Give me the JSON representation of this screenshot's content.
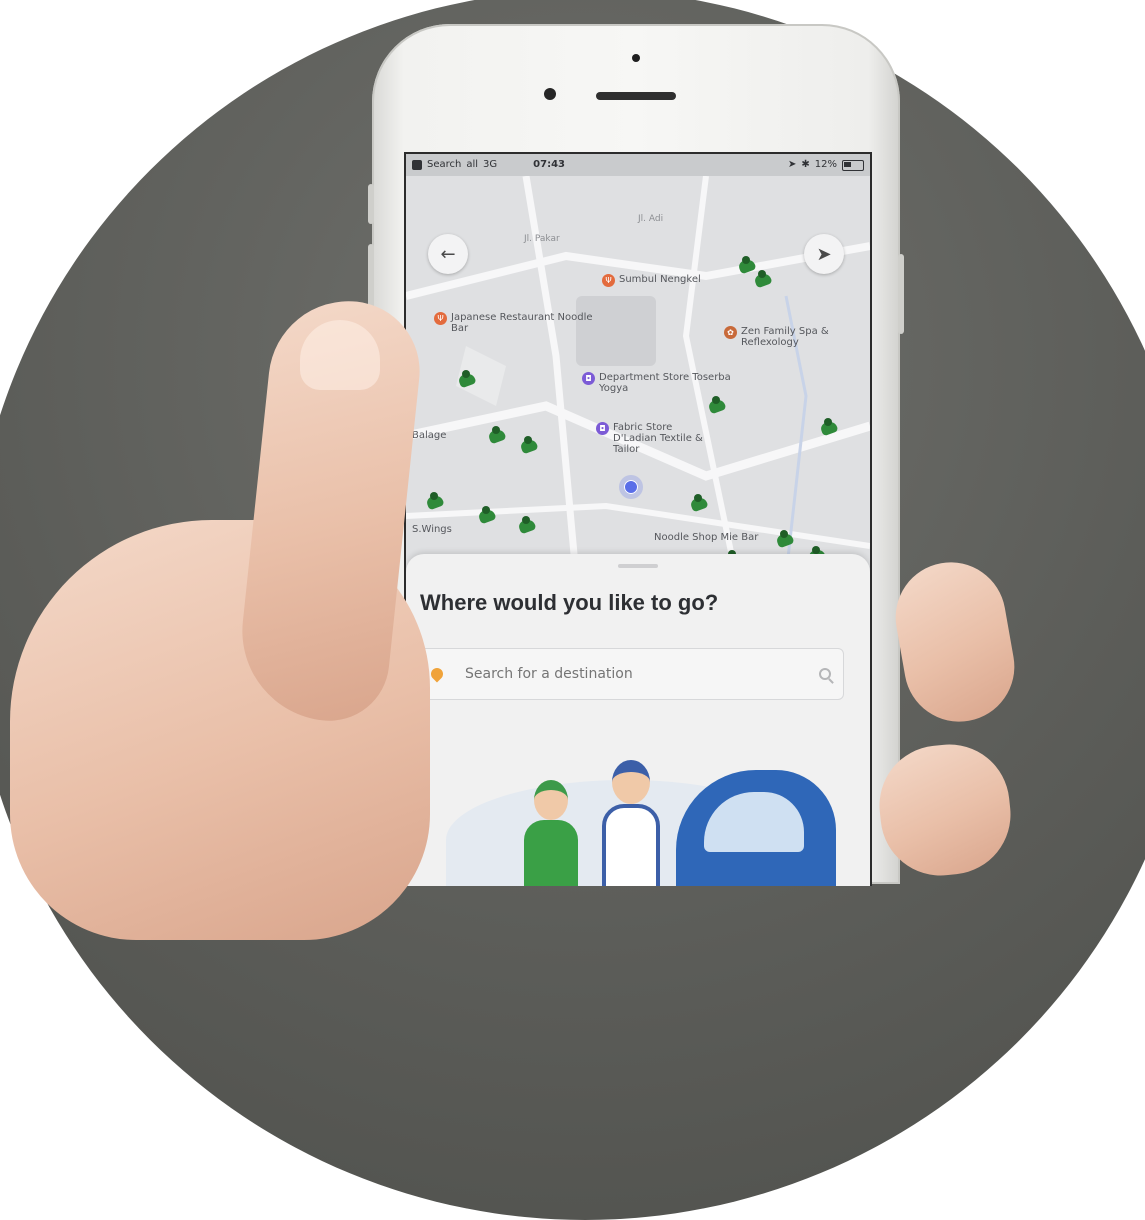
{
  "status_bar": {
    "carrier": "Search",
    "signal": "all",
    "network": "3G",
    "time": "07:43",
    "battery": "12%"
  },
  "map": {
    "streets": [
      "Jl. Adi",
      "Jl. Pakar"
    ],
    "pois": [
      {
        "label": "Sumbul Nengkel",
        "category": "food"
      },
      {
        "label": "Japanese Restaurant Noodle Bar",
        "category": "food"
      },
      {
        "label": "Zen Family Spa & Reflexology",
        "category": "spa"
      },
      {
        "label": "Department Store Toserba Yogya",
        "category": "shop"
      },
      {
        "label": "Fabric Store D'Ladian Textile & Tailor",
        "category": "shop"
      },
      {
        "label": "Balage",
        "category": "food"
      },
      {
        "label": "Noodle Shop Mie Bar",
        "category": "food"
      },
      {
        "label": "S.Wings",
        "category": "food"
      }
    ]
  },
  "sheet": {
    "title": "Where would you like to go?",
    "search_placeholder": "Search for a destination"
  },
  "colors": {
    "accent_green": "#2f8a3a",
    "pin_orange": "#e36b3d",
    "pin_purple": "#7c5bd6",
    "location_blue": "#5a6ee8",
    "search_icon_orange": "#f0a33a"
  }
}
